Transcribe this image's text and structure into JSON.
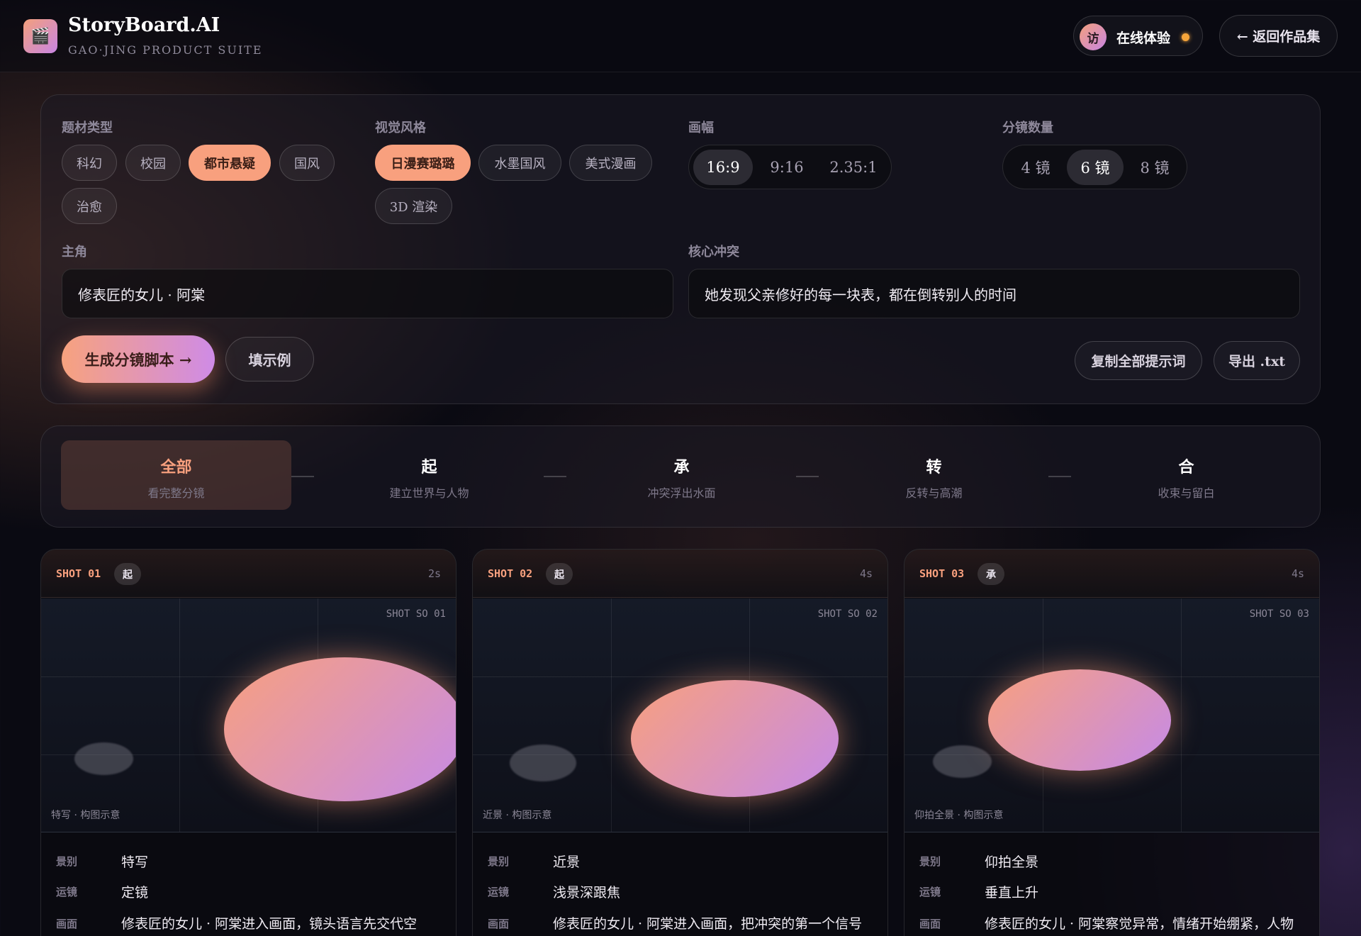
{
  "header": {
    "logo_icon": "clapperboard-icon",
    "logo_glyph": "🎬",
    "title": "StoryBoard.AI",
    "subtitle": "GAO·JING PRODUCT SUITE",
    "avatar_text": "访",
    "user_label": "在线体验",
    "back_label": "← 返回作品集"
  },
  "form": {
    "genre": {
      "label": "题材类型",
      "options": [
        "科幻",
        "校园",
        "都市悬疑",
        "国风",
        "治愈"
      ],
      "selected": "都市悬疑"
    },
    "style": {
      "label": "视觉风格",
      "options": [
        "日漫赛璐璐",
        "水墨国风",
        "美式漫画",
        "3D 渲染"
      ],
      "selected": "日漫赛璐璐"
    },
    "ratio": {
      "label": "画幅",
      "options": [
        "16:9",
        "9:16",
        "2.35:1"
      ],
      "selected": "16:9"
    },
    "count": {
      "label": "分镜数量",
      "options": [
        "4 镜",
        "6 镜",
        "8 镜"
      ],
      "selected": "6 镜"
    },
    "protagonist": {
      "label": "主角",
      "value": "修表匠的女儿 · 阿棠"
    },
    "conflict": {
      "label": "核心冲突",
      "value": "她发现父亲修好的每一块表，都在倒转别人的时间"
    },
    "generate_label": "生成分镜脚本 →",
    "example_label": "填示例",
    "copy_label": "复制全部提示词",
    "export_label": "导出 .txt"
  },
  "acts": [
    {
      "title": "全部",
      "sub": "看完整分镜",
      "active": true
    },
    {
      "title": "起",
      "sub": "建立世界与人物"
    },
    {
      "title": "承",
      "sub": "冲突浮出水面"
    },
    {
      "title": "转",
      "sub": "反转与高潮"
    },
    {
      "title": "合",
      "sub": "收束与留白"
    }
  ],
  "shots": [
    {
      "id": "SHOT 01",
      "act": "起",
      "duration": "2s",
      "tag": "SHOT SO 01",
      "caption": "特写 · 构图示意",
      "rows": [
        {
          "k": "景别",
          "v": "特写"
        },
        {
          "k": "运镜",
          "v": "定镜"
        },
        {
          "k": "画面",
          "v": "修表匠的女儿 · 阿棠进入画面，镜头语言先交代空"
        }
      ]
    },
    {
      "id": "SHOT 02",
      "act": "起",
      "duration": "4s",
      "tag": "SHOT SO 02",
      "caption": "近景 · 构图示意",
      "rows": [
        {
          "k": "景别",
          "v": "近景"
        },
        {
          "k": "运镜",
          "v": "浅景深跟焦"
        },
        {
          "k": "画面",
          "v": "修表匠的女儿 · 阿棠进入画面，把冲突的第一个信号"
        }
      ]
    },
    {
      "id": "SHOT 03",
      "act": "承",
      "duration": "4s",
      "tag": "SHOT SO 03",
      "caption": "仰拍全景 · 构图示意",
      "rows": [
        {
          "k": "景别",
          "v": "仰拍全景"
        },
        {
          "k": "运镜",
          "v": "垂直上升"
        },
        {
          "k": "画面",
          "v": "修表匠的女儿 · 阿棠察觉异常，情绪开始绷紧，人物"
        }
      ]
    }
  ]
}
